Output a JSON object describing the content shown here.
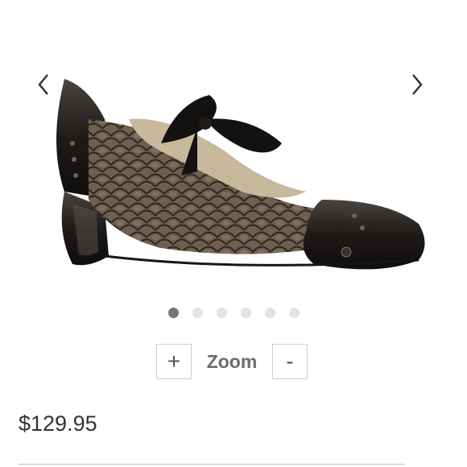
{
  "gallery": {
    "prev_icon": "chevron-left-icon",
    "next_icon": "chevron-right-icon",
    "image_alt": "product-shoe",
    "total_images": 6,
    "active_index": 0
  },
  "zoom": {
    "zoom_in_label": "+",
    "label": "Zoom",
    "zoom_out_label": "-"
  },
  "product": {
    "price": "$129.95"
  },
  "colors": {
    "dot_active": "#777777",
    "dot_inactive": "#e3e3e3",
    "text": "#333333"
  }
}
